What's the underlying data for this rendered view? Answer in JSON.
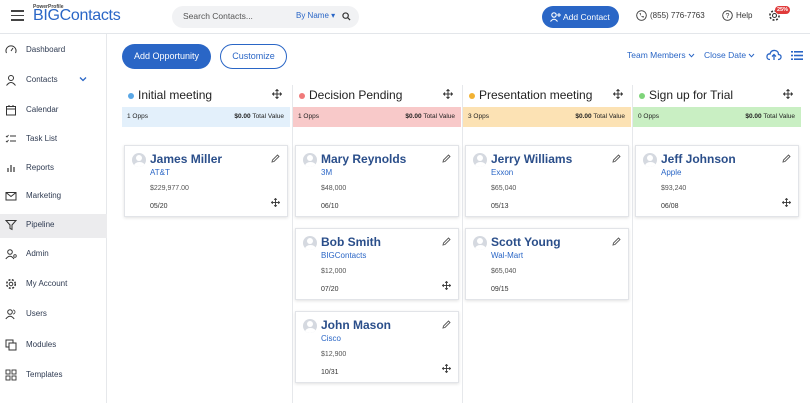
{
  "brand": {
    "small": "PowerProfile",
    "name": "BIGContacts"
  },
  "search": {
    "placeholder": "Search Contacts...",
    "filter": "By Name"
  },
  "header": {
    "add_contact": "Add Contact",
    "phone": "(855) 776-7763",
    "help": "Help",
    "badge": "25%"
  },
  "sidebar": {
    "items": [
      {
        "label": "Dashboard",
        "icon": "gauge-icon"
      },
      {
        "label": "Contacts",
        "icon": "person-icon"
      },
      {
        "label": "Calendar",
        "icon": "calendar-icon"
      },
      {
        "label": "Task List",
        "icon": "checklist-icon"
      },
      {
        "label": "Reports",
        "icon": "bar-chart-icon"
      },
      {
        "label": "Marketing",
        "icon": "envelope-icon"
      },
      {
        "label": "Pipeline",
        "icon": "funnel-icon"
      },
      {
        "label": "Admin",
        "icon": "admin-icon"
      },
      {
        "label": "My Account",
        "icon": "gear-icon"
      },
      {
        "label": "Users",
        "icon": "users-icon"
      },
      {
        "label": "Modules",
        "icon": "modules-icon"
      },
      {
        "label": "Templates",
        "icon": "grid-icon"
      }
    ]
  },
  "toolbar": {
    "add_opportunity": "Add Opportunity",
    "customize": "Customize",
    "team_members": "Team Members",
    "close_date": "Close Date"
  },
  "columns": [
    {
      "title": "Initial meeting",
      "dot": "#5aa7e6",
      "bg": "#e3f0fb",
      "opps": "1 Opps",
      "total": "$0.00",
      "total_label": "Total Value",
      "cards": [
        {
          "name": "James Miller",
          "company": "AT&T",
          "amount": "$229,977.00",
          "date": "05/20"
        }
      ]
    },
    {
      "title": "Decision Pending",
      "dot": "#f07a7a",
      "bg": "#f8c9c9",
      "opps": "1 Opps",
      "total": "$0.00",
      "total_label": "Total Value",
      "cards": [
        {
          "name": "Mary Reynolds",
          "company": "3M",
          "amount": "$48,000",
          "date": "06/10"
        },
        {
          "name": "Bob Smith",
          "company": "BIGContacts",
          "amount": "$12,000",
          "date": "07/20"
        },
        {
          "name": "John Mason",
          "company": "Cisco",
          "amount": "$12,900",
          "date": "10/31"
        }
      ]
    },
    {
      "title": "Presentation meeting",
      "dot": "#f2b233",
      "bg": "#fce2b4",
      "opps": "3 Opps",
      "total": "$0.00",
      "total_label": "Total Value",
      "cards": [
        {
          "name": "Jerry Williams",
          "company": "Exxon",
          "amount": "$65,040",
          "date": "05/13"
        },
        {
          "name": "Scott Young",
          "company": "Wal-Mart",
          "amount": "$65,040",
          "date": "09/15"
        }
      ]
    },
    {
      "title": "Sign up for Trial",
      "dot": "#7fd47a",
      "bg": "#c9efc3",
      "opps": "0 Opps",
      "total": "$0.00",
      "total_label": "Total Value",
      "cards": [
        {
          "name": "Jeff Johnson",
          "company": "Apple",
          "amount": "$93,240",
          "date": "06/08"
        }
      ]
    }
  ]
}
